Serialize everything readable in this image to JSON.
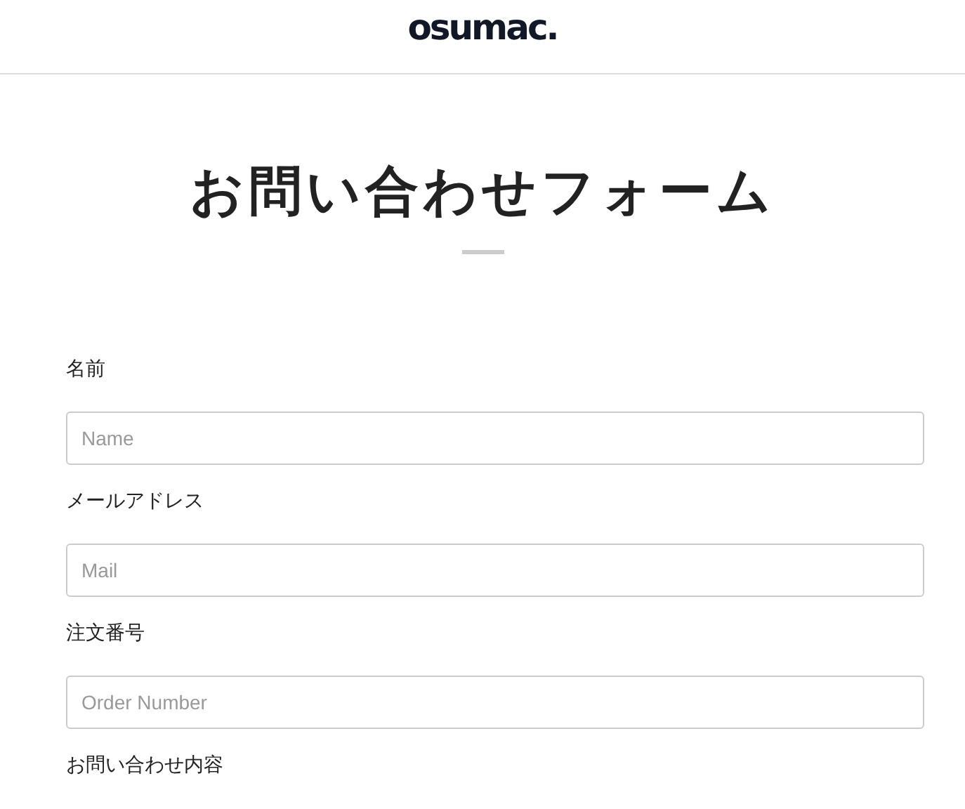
{
  "header": {
    "logo": "osumac."
  },
  "title": "お問い合わせフォーム",
  "fields": [
    {
      "label": "名前",
      "placeholder": "Name"
    },
    {
      "label": "メールアドレス",
      "placeholder": "Mail"
    },
    {
      "label": "注文番号",
      "placeholder": "Order Number"
    },
    {
      "label": "お問い合わせ内容"
    }
  ]
}
